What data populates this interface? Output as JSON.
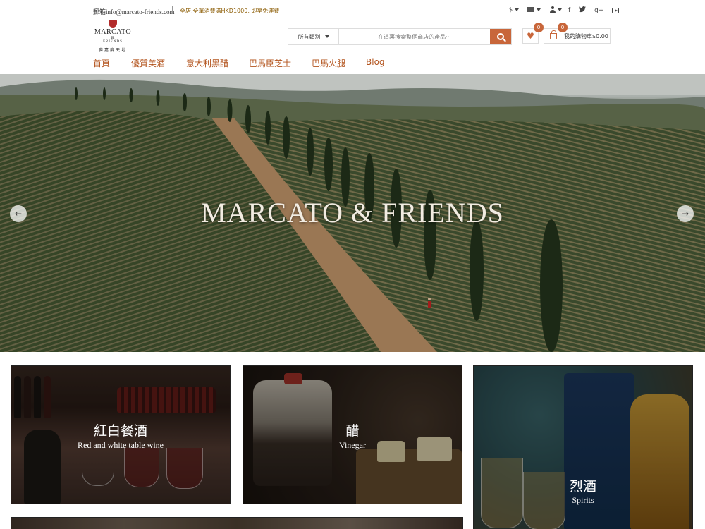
{
  "topbar": {
    "email_label": "郵箱",
    "email": "info@marcato-friends.com",
    "promo": "全店,全單消費滿HKD1000, 即享免運費",
    "currency": "$",
    "language_flag": "flag-icon",
    "account": "user-icon"
  },
  "social": {
    "facebook": "f",
    "twitter": "twitter-icon",
    "googleplus": "g+",
    "youtube": "youtube-icon"
  },
  "logo": {
    "brand": "MARCATO",
    "amp": "&",
    "friends": "FRIENDS",
    "chinese": "麥嘉度天地"
  },
  "search": {
    "category": "所有類別",
    "placeholder": "在這裏搜索整個商店的產品···"
  },
  "wishlist": {
    "count": "0"
  },
  "cart": {
    "count": "0",
    "label": "我的購物車$0.00"
  },
  "nav": {
    "items": [
      "首頁",
      "優質美酒",
      "意大利黑醋",
      "巴馬臣芝士",
      "巴馬火腿",
      "Blog"
    ]
  },
  "hero": {
    "title": "MARCATO & FRIENDS"
  },
  "categories": [
    {
      "cn": "紅白餐酒",
      "en": "Red and white table wine"
    },
    {
      "cn": "醋",
      "en": "Vinegar"
    },
    {
      "cn": "烈酒",
      "en": "Spirits"
    }
  ],
  "colors": {
    "accent": "#c8663a",
    "nav_text": "#b3541e",
    "promo_text": "#8a5a00"
  }
}
